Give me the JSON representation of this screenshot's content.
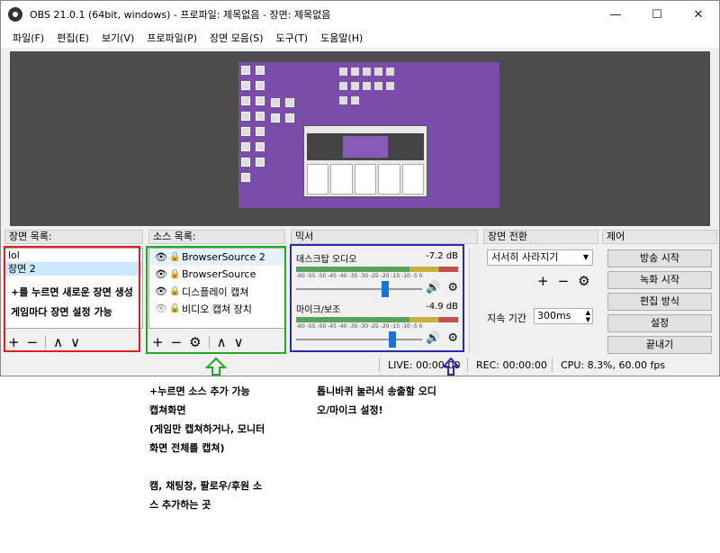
{
  "window": {
    "title": "OBS 21.0.1 (64bit, windows) - 프로파일: 제목없음 - 장면: 제목없음",
    "minimize": "—",
    "maximize": "☐",
    "close": "✕"
  },
  "menu": [
    "파일(F)",
    "편집(E)",
    "보기(V)",
    "프로파일(P)",
    "장면 모음(S)",
    "도구(T)",
    "도움말(H)"
  ],
  "scenes": {
    "header": "장면 목록:",
    "items": [
      "lol",
      "장면 2"
    ],
    "annotation_line1": "+를 누르면 새로운 장면 생성",
    "annotation_line2": "게임마다 장면 설정 가능",
    "add": "+",
    "remove": "−",
    "up": "∧",
    "down": "∨"
  },
  "sources": {
    "header": "소스 목록:",
    "items": [
      "BrowserSource 2",
      "BrowserSource",
      "디스플레이 캡쳐",
      "비디오 캡쳐 장치"
    ],
    "add": "+",
    "remove": "−",
    "gear": "⚙",
    "up": "∧",
    "down": "∨"
  },
  "mixer": {
    "header": "믹서",
    "channels": [
      {
        "name": "데스크탑 오디오",
        "db": "-7.2 dB",
        "level": 0.72
      },
      {
        "name": "마이크/보조",
        "db": "-4.9 dB",
        "level": 0.78
      }
    ],
    "scale": "-60 -55 -50 -45 -40 -35 -30 -25 -20 -15 -10 -5 0"
  },
  "transitions": {
    "header": "장면 전환",
    "selected": "서서히 사라지기",
    "duration_label": "지속 기간",
    "duration_value": "300ms",
    "add": "+",
    "remove": "−",
    "gear": "⚙"
  },
  "controls": {
    "header": "제어",
    "buttons": [
      "방송 시작",
      "녹화 시작",
      "편집 방식",
      "설정",
      "끝내기"
    ]
  },
  "status": {
    "live": "LIVE: 00:00:00",
    "rec": "REC: 00:00:00",
    "cpu": "CPU: 8.3%, 60.00 fps"
  },
  "annotations": {
    "sources_note": "+누르면 소스 추가 가능\n캡쳐화면\n(게임만 캡쳐하거나, 모니터\n화면 전체를 캡쳐)\n\n캠, 채팅창, 팔로우/후원 소\n스 추가하는 곳",
    "mixer_note": "톱니바퀴 눌러서 송출할 오디\n오/마이크 설정!"
  },
  "colors": {
    "scene_box": "#e02020",
    "source_box": "#22aa22",
    "mixer_box": "#2a2ab0",
    "accent": "#1874d5"
  }
}
